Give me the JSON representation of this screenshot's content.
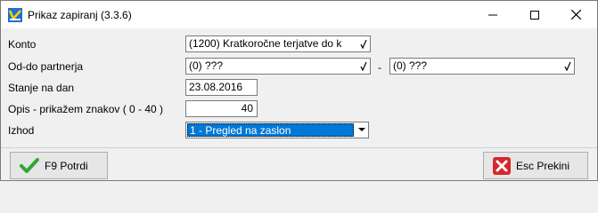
{
  "window": {
    "title": "Prikaz zapiranj  (3.3.6)"
  },
  "form": {
    "konto": {
      "label": "Konto",
      "value": "(1200) Kratkoročne terjatve do k"
    },
    "partner": {
      "label": "Od-do partnerja",
      "from": "(0) ???",
      "separator": "-",
      "to": "(0) ???"
    },
    "stanje": {
      "label": "Stanje na dan",
      "value": "23.08.2016"
    },
    "opis": {
      "label": "Opis - prikažem znakov ( 0 - 40 )",
      "value": "40"
    },
    "izhod": {
      "label": "Izhod",
      "value": "1 - Pregled na zaslon"
    }
  },
  "buttons": {
    "confirm": "F9 Potrdi",
    "cancel": "Esc Prekini"
  },
  "colors": {
    "selection": "#0078d7",
    "check": "#2fa82f",
    "cancel": "#d8262e"
  }
}
